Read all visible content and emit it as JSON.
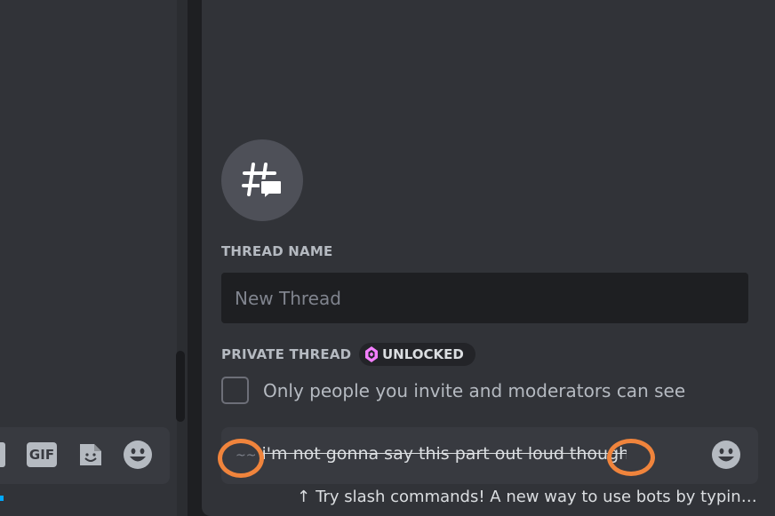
{
  "left_chat": {
    "gif_label": "GIF"
  },
  "thread_form": {
    "thread_name_label": "THREAD NAME",
    "thread_name_placeholder": "New Thread",
    "thread_name_value": "",
    "private_thread_label": "PRIVATE THREAD",
    "unlocked_badge": "UNLOCKED",
    "private_checkbox_checked": false,
    "private_checkbox_label": "Only people you invite and moderators can see"
  },
  "composer": {
    "open_marker": "~~",
    "message_text": "i'm not gonna say this part out loud though",
    "close_marker": "~~"
  },
  "hint": {
    "arrow": "↑",
    "text": "Try slash commands! A new way to use bots by typing sl..."
  },
  "colors": {
    "accent_annotation": "#f0843c",
    "nitro_gem": "#f47fff"
  }
}
